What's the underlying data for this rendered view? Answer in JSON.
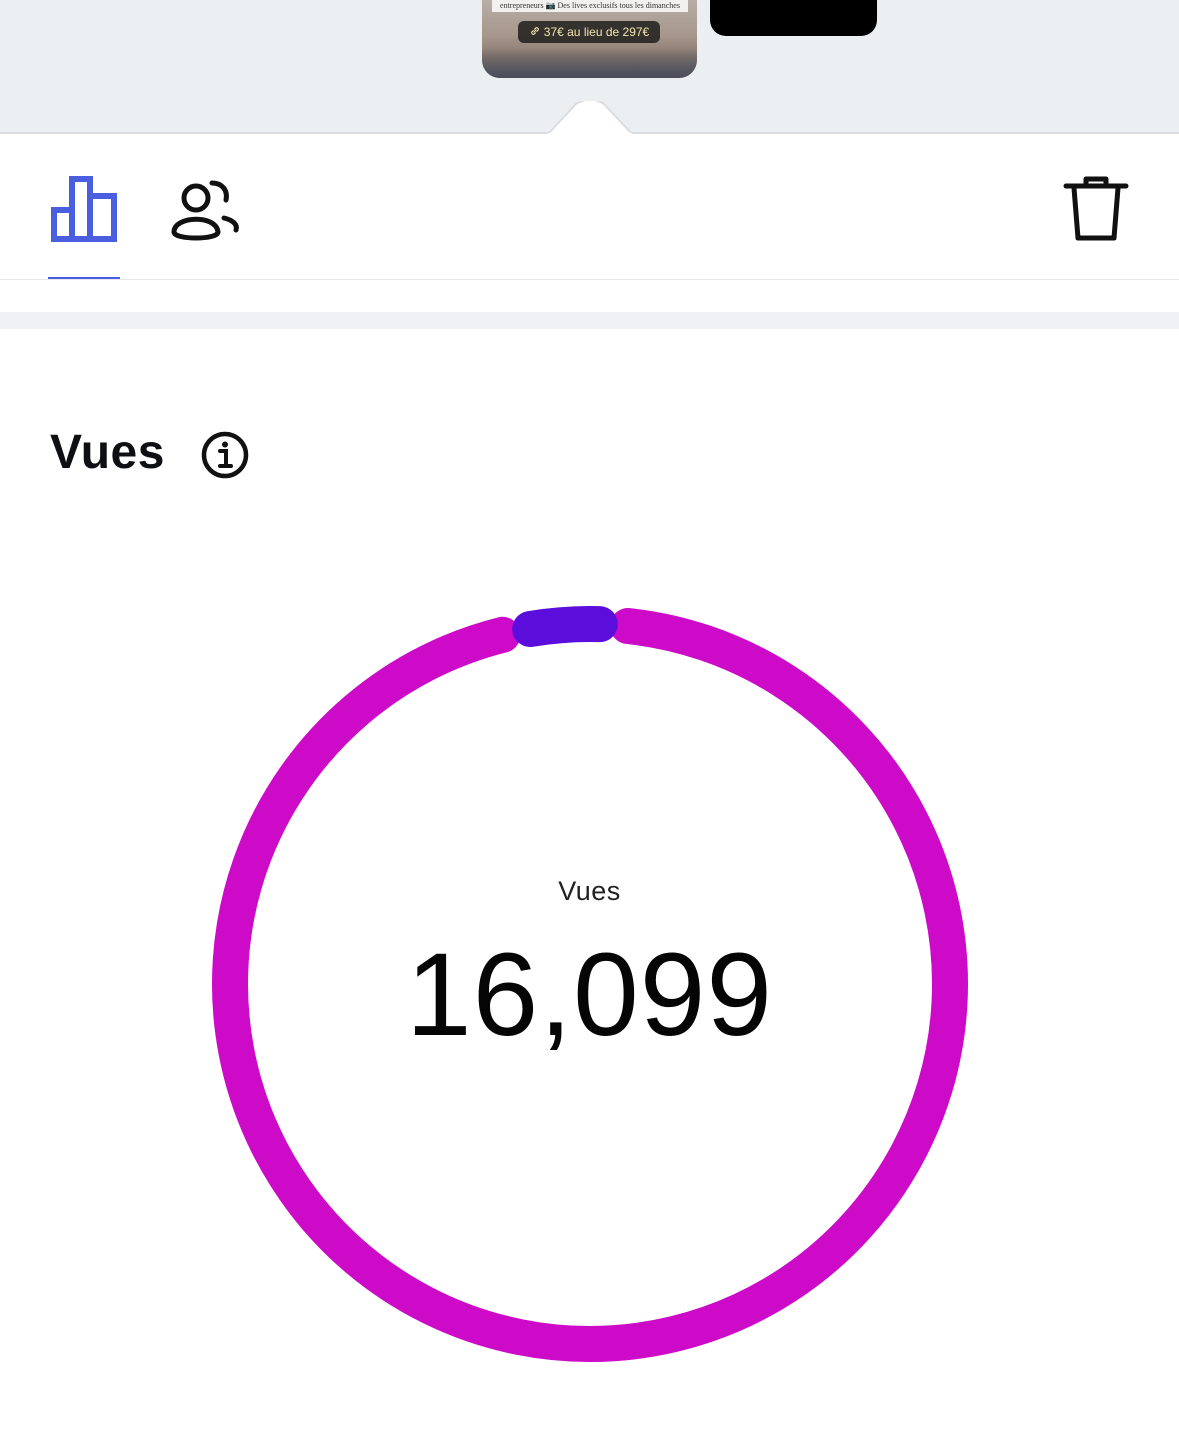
{
  "story_strip": {
    "thumbnail_text": "entrepreneurs 📷 Des lives exclusifs tous les dimanches",
    "link_sticker": "37€ au lieu de 297€"
  },
  "tabs": [
    {
      "name": "stats",
      "icon": "bar-chart-icon",
      "active": true
    },
    {
      "name": "audience",
      "icon": "people-icon",
      "active": false
    }
  ],
  "actions": {
    "delete_icon": "trash-icon"
  },
  "section": {
    "title": "Vues",
    "info_icon": "info-icon"
  },
  "chart_data": {
    "type": "donut",
    "center_label": "Vues",
    "total": "16,099",
    "segments": [
      {
        "color": "#cc0ac7",
        "fraction": 0.963
      },
      {
        "color": "#5a0ddb",
        "fraction": 0.037
      }
    ]
  },
  "colors": {
    "accent": "#4a5fe0",
    "followers_segment": "#5a0ddb",
    "non_followers_segment": "#cc0ac7"
  }
}
